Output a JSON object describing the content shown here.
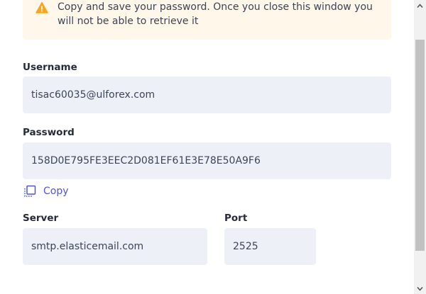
{
  "alert": {
    "icon": "warning-triangle-icon",
    "text": "Copy and save your password. Once you close this window you will not be able to retrieve it",
    "accent_color": "#f5a623",
    "background": "#fef7ea"
  },
  "username": {
    "label": "Username",
    "value": "tisac60035@ulforex.com"
  },
  "password": {
    "label": "Password",
    "value": "158D0E795FE3EEC2D081EF61E3E78E50A9F6"
  },
  "copy": {
    "label": "Copy",
    "icon": "copy-icon",
    "color": "#4f57d6"
  },
  "server": {
    "label": "Server",
    "value": "smtp.elasticemail.com"
  },
  "port": {
    "label": "Port",
    "value": "2525"
  },
  "scrollbar": {
    "up_icon": "chevron-up-icon",
    "down_icon": "chevron-down-icon"
  }
}
